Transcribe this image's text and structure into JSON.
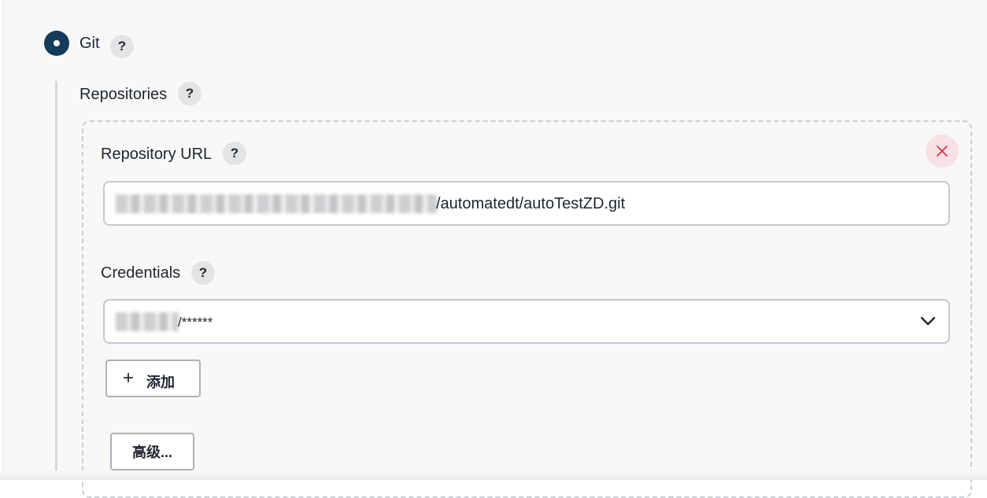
{
  "scm": {
    "option_label": "Git",
    "option_selected": true,
    "help_icon": "?"
  },
  "repositories": {
    "label": "Repositories",
    "help_icon": "?",
    "remove_icon": "close-icon",
    "url": {
      "label": "Repository URL",
      "help_icon": "?",
      "value_visible": "/automatedt/autoTestZD.git"
    },
    "credentials": {
      "label": "Credentials",
      "help_icon": "?",
      "selected_visible": "/******",
      "dropdown_icon": "chevron-down-icon"
    },
    "add_button": {
      "icon": "+",
      "label": "添加"
    },
    "advanced_button": {
      "label": "高级..."
    }
  },
  "colors": {
    "radio": "#143a5c",
    "close_bg": "#f8e1e5",
    "close_x": "#d9324a",
    "panel_bg": "#f8f8f8"
  }
}
